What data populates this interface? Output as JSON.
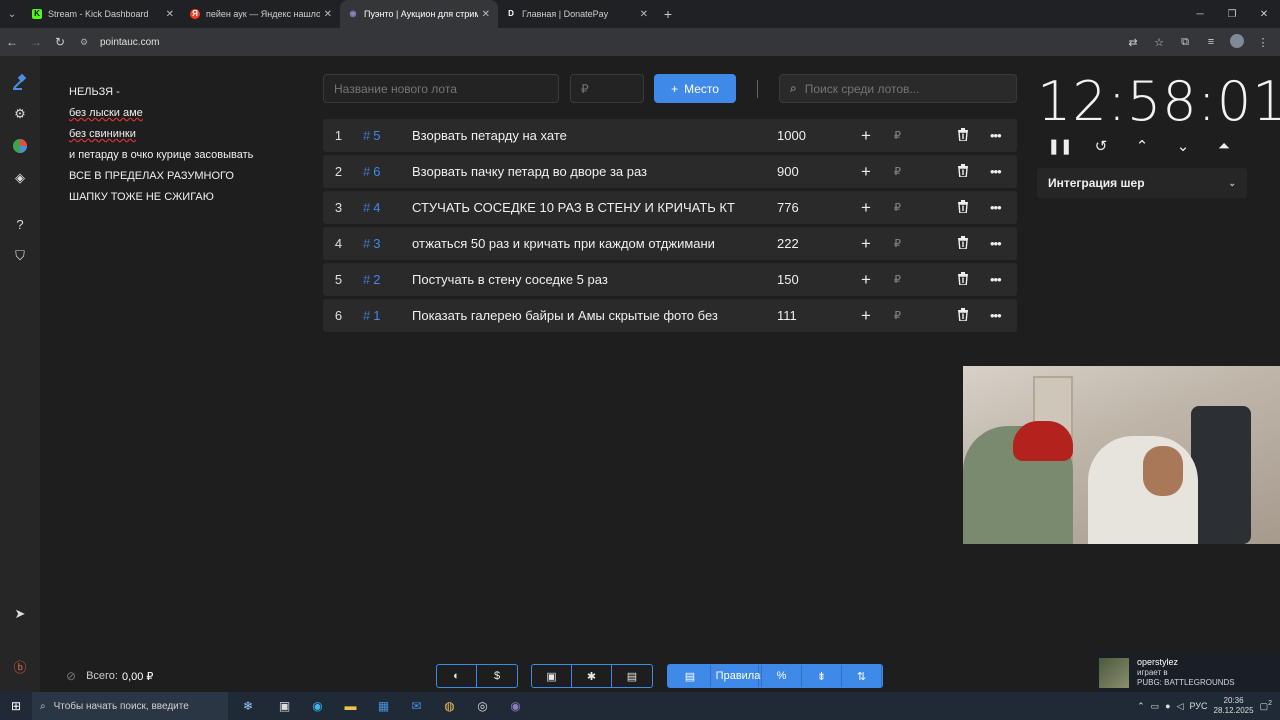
{
  "browser": {
    "tabs": [
      {
        "title": "Stream - Kick Dashboard",
        "favicon": "K",
        "favicon_color": "#53fc18"
      },
      {
        "title": "пейен аук — Яндекс нашлось",
        "favicon": "Я",
        "favicon_color": "#fc3f1d"
      },
      {
        "title": "Пуэнто | Аукцион для стриме",
        "favicon": "◉",
        "favicon_color": "#8e7cc3"
      },
      {
        "title": "Главная | DonatePay",
        "favicon": "D",
        "favicon_color": "#ffffff"
      }
    ],
    "address": "pointauc.com"
  },
  "rules_text": [
    "НЕЛЬЗЯ -",
    "без лыски аме",
    "без свининки",
    "и петарду в очко курице засовывать",
    "ВСЕ В ПРЕДЕЛАХ РАЗУМНОГО",
    "ШАПКУ ТОЖЕ НЕ СЖИГАЮ"
  ],
  "new_lot": {
    "name_placeholder": "Название нового лота",
    "price_placeholder": "₽",
    "place_button": "Место",
    "search_placeholder": "Поиск среди лотов..."
  },
  "lots": [
    {
      "num": "1",
      "id": "5",
      "name": "Взорвать петарду на хате",
      "amount": "1000",
      "currency": "₽"
    },
    {
      "num": "2",
      "id": "6",
      "name": "Взорвать пачку петард во дворе за раз",
      "amount": "900",
      "currency": "₽"
    },
    {
      "num": "3",
      "id": "4",
      "name": "СТУЧАТЬ СОСЕДКЕ 10 РАЗ В СТЕНУ И КРИЧАТЬ КТ",
      "amount": "776",
      "currency": "₽"
    },
    {
      "num": "4",
      "id": "3",
      "name": "отжаться 50 раз и кричать при каждом отджимани",
      "amount": "222",
      "currency": "₽"
    },
    {
      "num": "5",
      "id": "2",
      "name": "Постучать в стену соседке 5 раз",
      "amount": "150",
      "currency": "₽"
    },
    {
      "num": "6",
      "id": "1",
      "name": "Показать галерею байры и Амы скрытые фото без",
      "amount": "111",
      "currency": "₽"
    }
  ],
  "timer": {
    "value": "12:58:01"
  },
  "integration": {
    "label": "Интеграция шер"
  },
  "footer": {
    "total_label": "Всего:",
    "total_value": "0,00 ₽",
    "rules_button": "Правила"
  },
  "notification": {
    "user": "operstylez",
    "line1": "играет в",
    "line2": "PUBG: BATTLEGROUNDS"
  },
  "taskbar": {
    "search_placeholder": "Чтобы начать поиск, введите",
    "lang": "РУС",
    "time": "20:36",
    "date": "28.12.2025",
    "notif_count": "2"
  },
  "colors": {
    "accent": "#3f89e8",
    "background": "#1e1e1e",
    "row": "#2a2a2a"
  }
}
